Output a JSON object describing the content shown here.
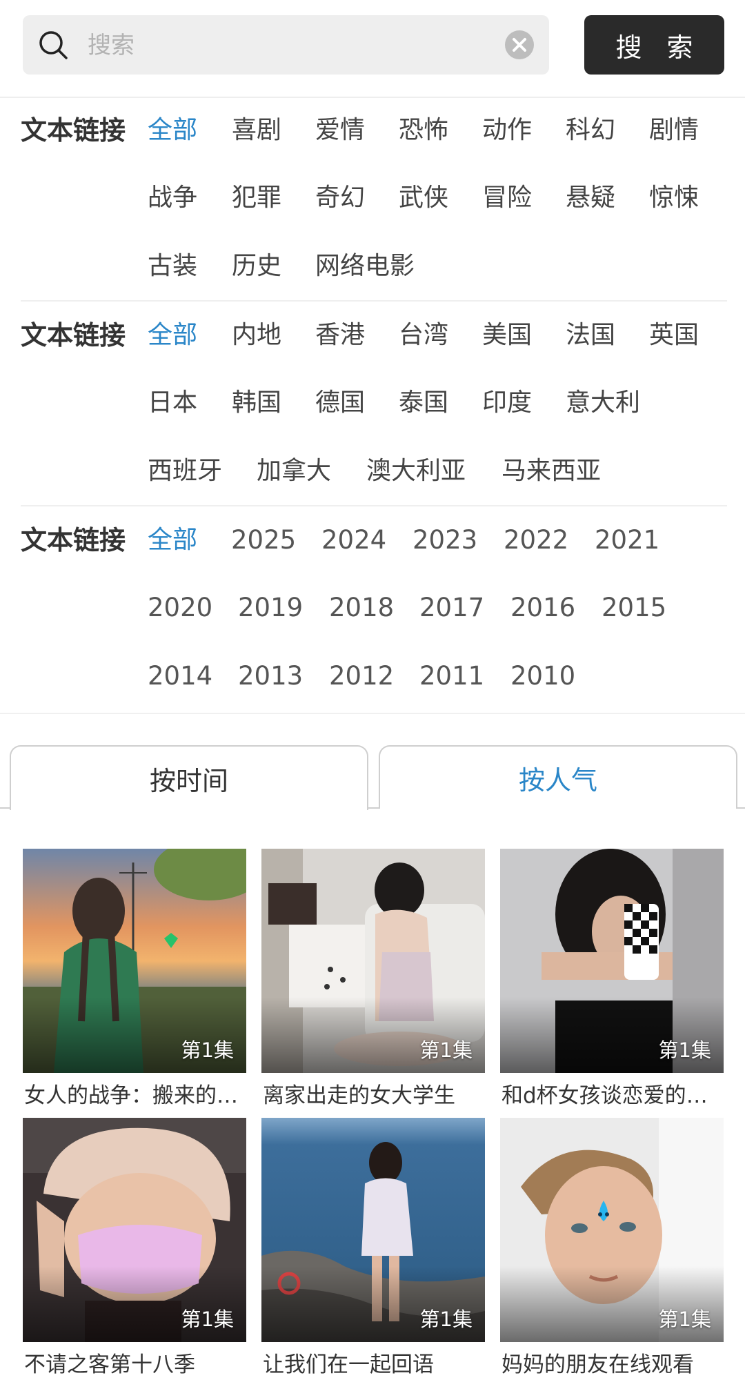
{
  "search": {
    "placeholder": "搜索",
    "button_label": "搜 索"
  },
  "filters": [
    {
      "label": "文本链接",
      "options": [
        "全部",
        "喜剧",
        "爱情",
        "恐怖",
        "动作",
        "科幻",
        "剧情",
        "战争",
        "犯罪",
        "奇幻",
        "武侠",
        "冒险",
        "悬疑",
        "惊悚",
        "古装",
        "历史",
        "网络电影"
      ],
      "active": "全部"
    },
    {
      "label": "文本链接",
      "options": [
        "全部",
        "内地",
        "香港",
        "台湾",
        "美国",
        "法国",
        "英国",
        "日本",
        "韩国",
        "德国",
        "泰国",
        "印度",
        "意大利",
        "西班牙",
        "加拿大",
        "澳大利亚",
        "马来西亚"
      ],
      "active": "全部"
    },
    {
      "label": "文本链接",
      "options": [
        "全部",
        "2025",
        "2024",
        "2023",
        "2022",
        "2021",
        "2020",
        "2019",
        "2018",
        "2017",
        "2016",
        "2015",
        "2014",
        "2013",
        "2012",
        "2011",
        "2010"
      ],
      "active": "全部"
    }
  ],
  "sort_tabs": [
    {
      "label": "按时间"
    },
    {
      "label": "按人气"
    }
  ],
  "videos": [
    {
      "title": "女人的战争：搬来的女孩",
      "episode": "第1集"
    },
    {
      "title": "离家出走的女大学生",
      "episode": "第1集"
    },
    {
      "title": "和d杯女孩谈恋爱的日子",
      "episode": "第1集"
    },
    {
      "title": "不请之客第十八季",
      "episode": "第1集"
    },
    {
      "title": "让我们在一起回语",
      "episode": "第1集"
    },
    {
      "title": "妈妈的朋友在线观看",
      "episode": "第1集"
    }
  ],
  "colors": {
    "accent": "#2a86c8",
    "search_button": "#2a2a2a",
    "search_field": "#eeeeee"
  },
  "icons": {
    "search": "magnifier-icon",
    "clear": "clear-x-circle-icon"
  }
}
